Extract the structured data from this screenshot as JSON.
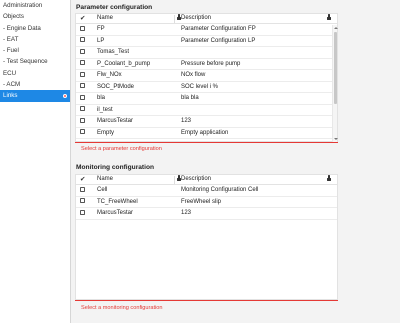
{
  "sidebar": {
    "items": [
      {
        "label": "Administration",
        "active": false
      },
      {
        "label": "Objects",
        "active": false
      },
      {
        "label": "- Engine Data",
        "active": false
      },
      {
        "label": "- EAT",
        "active": false
      },
      {
        "label": "- Fuel",
        "active": false
      },
      {
        "label": "- Test Sequence",
        "active": false
      },
      {
        "label": "ECU",
        "active": false
      },
      {
        "label": "- ACM",
        "active": false
      },
      {
        "label": "Links",
        "active": true
      }
    ]
  },
  "parameter_config": {
    "title": "Parameter configuration",
    "columns": {
      "check": "✔",
      "name": "Name",
      "description": "Description"
    },
    "rows": [
      {
        "name": "FP",
        "description": "Parameter Configuration FP"
      },
      {
        "name": "LP",
        "description": "Parameter Configuration LP"
      },
      {
        "name": "Tomas_Test",
        "description": ""
      },
      {
        "name": "P_Coolant_b_pump",
        "description": "Pressure before pump"
      },
      {
        "name": "Flw_NOx",
        "description": "NOx flow"
      },
      {
        "name": "SOC_PtMode",
        "description": "SOC level i %"
      },
      {
        "name": "bla",
        "description": "bla bla"
      },
      {
        "name": "il_test",
        "description": ""
      },
      {
        "name": "MarcusTestar",
        "description": "123"
      },
      {
        "name": "Empty",
        "description": "Empty application"
      }
    ],
    "hint": "Select a parameter configuration"
  },
  "monitoring_config": {
    "title": "Monitoring configuration",
    "columns": {
      "check": "✔",
      "name": "Name",
      "description": "Description"
    },
    "rows": [
      {
        "name": "Cell",
        "description": "Monitoring Configuration Cell"
      },
      {
        "name": "TC_FreeWheel",
        "description": "FreeWheel slip"
      },
      {
        "name": "MarcusTestar",
        "description": "123"
      }
    ],
    "hint": "Select a monitoring configuration"
  },
  "colors": {
    "accent": "#1e88e5",
    "error": "#e53935",
    "badge": "#ff5a5a"
  }
}
